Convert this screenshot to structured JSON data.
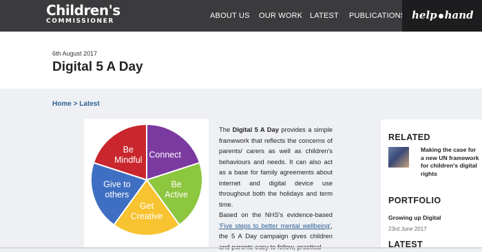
{
  "logo": {
    "main": "Children's",
    "sub": "COMMISSIONER"
  },
  "nav": [
    "ABOUT US",
    "OUR WORK",
    "LATEST",
    "PUBLICATIONS"
  ],
  "help": {
    "left": "help",
    "right": "hand"
  },
  "article": {
    "date": "6th August 2017",
    "title": "Digital 5 A Day"
  },
  "breadcrumb": {
    "home": "Home",
    "sep": " > ",
    "current": "Latest"
  },
  "pie": {
    "slices": [
      {
        "label_lines": [
          "Connect"
        ],
        "color": "#7b3aa0"
      },
      {
        "label_lines": [
          "Be",
          "Active"
        ],
        "color": "#8dc63f"
      },
      {
        "label_lines": [
          "Get",
          "Creative"
        ],
        "color": "#f7c330"
      },
      {
        "label_lines": [
          "Give to",
          "others"
        ],
        "color": "#3f6fc2"
      },
      {
        "label_lines": [
          "Be",
          "Mindful"
        ],
        "color": "#c9272d"
      }
    ]
  },
  "body": {
    "p1_pre": "The ",
    "p1_bold": "Digital 5 A Day",
    "p1_post": " provides a simple framework that reflects the concerns of parents/ carers as well as children's behaviours and needs. It can also act as a base for family agreements about internet and digital device use throughout both the holidays and term time.",
    "p2_pre": "Based on the NHS's evidence-based ",
    "p2_link": "'Five steps to better mental wellbeing'",
    "p2_post": ", the 5 A Day campaign gives children and parents easy to follow, practical"
  },
  "sidebar": {
    "related_heading": "RELATED",
    "related_item": "Making the case for a new UN framework for children's digital rights",
    "portfolio_heading": "PORTFOLIO",
    "portfolio_item": "Growing up Digital",
    "portfolio_date": "23rd June 2017",
    "latest_heading": "LATEST"
  }
}
